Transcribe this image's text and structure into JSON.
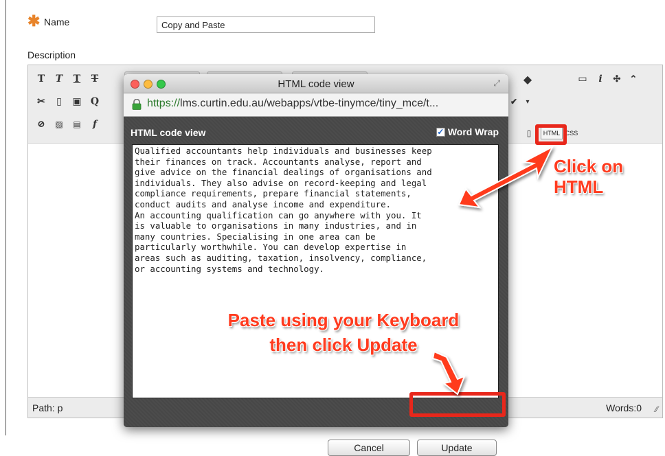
{
  "form": {
    "required_marker": "✱",
    "name_label": "Name",
    "name_value": "Copy and Paste",
    "description_label": "Description"
  },
  "editor": {
    "path_label": "Path: p",
    "words_label": "Words:0",
    "html_button": "HTML",
    "css_button": "CSS"
  },
  "popup": {
    "window_title": "HTML code view",
    "url_secure_part": "https://",
    "url_rest": "lms.curtin.edu.au/webapps/vtbe-tinymce/tiny_mce/t...",
    "pane_title": "HTML code view",
    "word_wrap_label": "Word Wrap",
    "word_wrap_checked": true,
    "code_text": "Qualified accountants help individuals and businesses keep\ntheir finances on track. Accountants analyse, report and\ngive advice on the financial dealings of organisations and\nindividuals. They also advise on record-keeping and legal\ncompliance requirements, prepare financial statements,\nconduct audits and analyse income and expenditure.\nAn accounting qualification can go anywhere with you. It\nis valuable to organisations in many industries, and in\nmany countries. Specialising in one area can be\nparticularly worthwhile. You can develop expertise in\nareas such as auditing, taxation, insolvency, compliance,\nor accounting systems and technology.",
    "cancel_label": "Cancel",
    "update_label": "Update"
  },
  "annotations": {
    "click_html_line1": "Click on",
    "click_html_line2": "HTML",
    "paste_line1": "Paste using your Keyboard",
    "paste_line2": "then click Update",
    "highlight_color": "#e8271b"
  }
}
